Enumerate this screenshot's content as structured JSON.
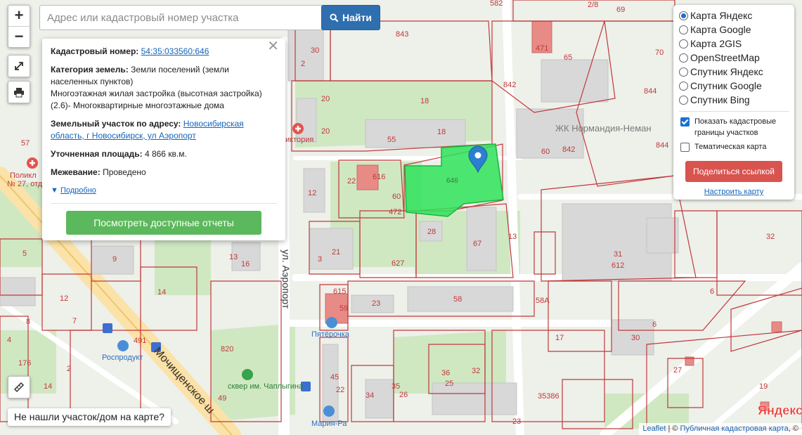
{
  "search": {
    "placeholder": "Адрес или кадастровый номер участка",
    "button_label": "Найти"
  },
  "zoom": {
    "in": "+",
    "out": "−"
  },
  "popup": {
    "cadastral_label": "Кадастровый номер:",
    "cadastral_value": "54:35:033560:646",
    "category_label": "Категория земель:",
    "category_value": "Земли поселений (земли населенных пунктов)",
    "use_text": "Многоэтажная жилая застройка (высотная застройка) (2.6)- Многоквартирные многоэтажные дома",
    "address_label": "Земельный участок по адресу:",
    "address_value": "Новосибирская область, г Новосибирск, ул Аэропорт",
    "area_label": "Уточненная площадь:",
    "area_value": "4 866 кв.м.",
    "survey_label": "Межевание:",
    "survey_value": "Проведено",
    "details_link": "Подробно",
    "reports_button": "Посмотреть доступные отчеты",
    "close_glyph": "✕"
  },
  "layers": {
    "options": [
      {
        "label": "Карта Яндекс",
        "selected": true
      },
      {
        "label": "Карта Google",
        "selected": false
      },
      {
        "label": "Карта 2GIS",
        "selected": false
      },
      {
        "label": "OpenStreetMap",
        "selected": false
      },
      {
        "label": "Спутник Яндекс",
        "selected": false
      },
      {
        "label": "Спутник Google",
        "selected": false
      },
      {
        "label": "Спутник Bing",
        "selected": false
      }
    ],
    "show_borders": {
      "label": "Показать кадастровые границы участков",
      "checked": true
    },
    "thematic": {
      "label": "Тематическая карта",
      "checked": false
    },
    "share_button": "Поделиться ссылкой",
    "configure_link": "Настроить карту"
  },
  "not_found_button": "Не нашли участок/дом на карте?",
  "attribution": {
    "leaflet": "Leaflet",
    "sep": " | © ",
    "pkk": "Публичная кадастровая карта",
    "tail": ", ©"
  },
  "map": {
    "selected_parcel": "646",
    "street_aeroport": "ул. Аэропорт",
    "street_mochishchenskoe": "Мочищенское ш",
    "poi_zhk": "ЖК Нормандия-Неман",
    "poi_pyaterochka": "Пятёрочка",
    "poi_rosprodukt": "Роспродукт",
    "poi_skver": "сквер им. Чаплыгина",
    "poi_maria_ra": "Мария-Ра",
    "poi_viktoria": "иктория",
    "poi_poliklinika": "Поликл",
    "poi_poliklinika_num": "№ 27, отд",
    "yandex_logo": "Яндекс",
    "parcel_numbers": [
      {
        "t": "843"
      },
      {
        "t": "842"
      },
      {
        "t": "842"
      },
      {
        "t": "844"
      },
      {
        "t": "844"
      },
      {
        "t": "70"
      },
      {
        "t": "65"
      },
      {
        "t": "60"
      },
      {
        "t": "18"
      },
      {
        "t": "18"
      },
      {
        "t": "20"
      },
      {
        "t": "20"
      },
      {
        "t": "55"
      },
      {
        "t": "30"
      },
      {
        "t": "2"
      },
      {
        "t": "22"
      },
      {
        "t": "12"
      },
      {
        "t": "472"
      },
      {
        "t": "60"
      },
      {
        "t": "616"
      },
      {
        "t": "28"
      },
      {
        "t": "67"
      },
      {
        "t": "13"
      },
      {
        "t": "627"
      },
      {
        "t": "21"
      },
      {
        "t": "3"
      },
      {
        "t": "58"
      },
      {
        "t": "58A"
      },
      {
        "t": "23"
      },
      {
        "t": "615"
      },
      {
        "t": "59"
      },
      {
        "t": "31"
      },
      {
        "t": "612"
      },
      {
        "t": "6"
      },
      {
        "t": "6"
      },
      {
        "t": "30"
      },
      {
        "t": "17"
      },
      {
        "t": "820"
      },
      {
        "t": "45"
      },
      {
        "t": "22"
      },
      {
        "t": "36"
      },
      {
        "t": "25"
      },
      {
        "t": "35"
      },
      {
        "t": "26"
      },
      {
        "t": "32"
      },
      {
        "t": "34"
      },
      {
        "t": "35386"
      },
      {
        "t": "23"
      },
      {
        "t": "9"
      },
      {
        "t": "14"
      },
      {
        "t": "13"
      },
      {
        "t": "16"
      },
      {
        "t": "12"
      },
      {
        "t": "7"
      },
      {
        "t": "8"
      },
      {
        "t": "57"
      },
      {
        "t": "5"
      },
      {
        "t": "49"
      },
      {
        "t": "14"
      },
      {
        "t": "491"
      },
      {
        "t": "32"
      },
      {
        "t": "2/8"
      },
      {
        "t": "582"
      },
      {
        "t": "69"
      },
      {
        "t": "471"
      },
      {
        "t": "2"
      },
      {
        "t": "4"
      },
      {
        "t": "176"
      },
      {
        "t": "27"
      },
      {
        "t": "19"
      }
    ]
  }
}
